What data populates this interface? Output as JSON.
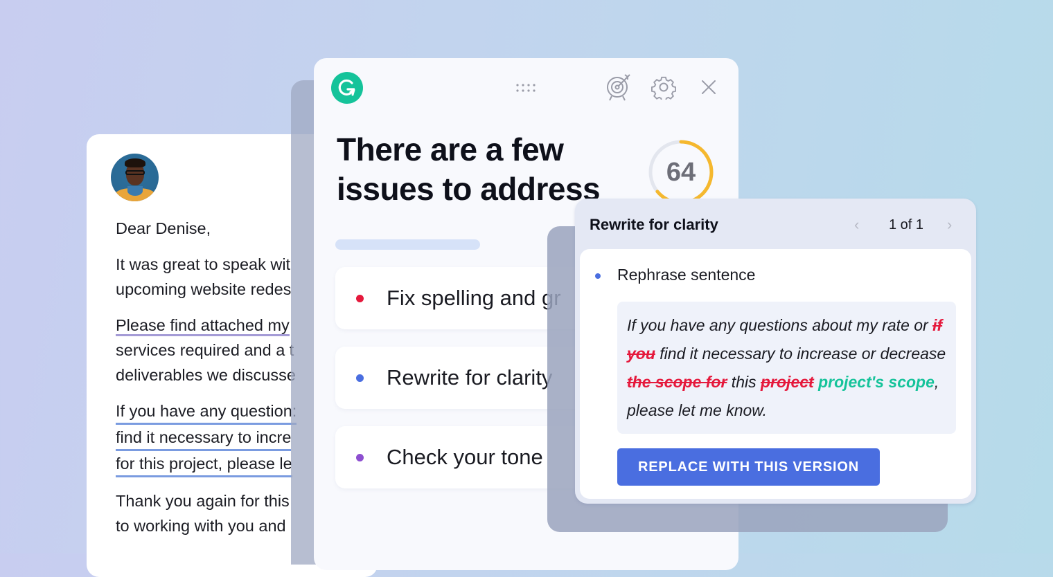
{
  "email": {
    "paragraphs": [
      {
        "lines": [
          "Dear Denise,"
        ]
      },
      {
        "lines": [
          "It was great to speak wit",
          "upcoming website redes"
        ]
      },
      {
        "lines": [
          "Please find attached my",
          "services required and a t",
          "deliverables we discusse"
        ]
      },
      {
        "lines": [
          "If you have any question:",
          "find it necessary to incre",
          "for this project, please le"
        ]
      },
      {
        "lines": [
          "Thank you again for this",
          "to working with you and"
        ]
      }
    ]
  },
  "panel": {
    "logo_icon": "grammarly-logo-icon",
    "drag_icon": "drag-handle-icon",
    "goals_icon": "target-icon",
    "settings_icon": "gear-icon",
    "close_icon": "close-icon",
    "headline_line1": "There are a few",
    "headline_line2": "issues to address",
    "score": {
      "value": "64",
      "fraction": 0.64
    },
    "progress_fraction": 0.2,
    "categories": [
      {
        "label": "Fix spelling and gr",
        "color": "#e5193c"
      },
      {
        "label": "Rewrite for clarity",
        "color": "#4a6ee0"
      },
      {
        "label": "Check your tone",
        "color": "#8d4fd0"
      }
    ]
  },
  "card": {
    "title": "Rewrite for clarity",
    "pager_prev": "‹",
    "pager_count": "1 of 1",
    "pager_next": "›",
    "suggestion_label": "Rephrase sentence",
    "diff": {
      "t1": "If you have any questions about my rate or ",
      "d1": "if you",
      "t2": " find it necessary to increase or decrease ",
      "d2": "the scope for",
      "t3": " this ",
      "d3": "project",
      "i1": "project's scope",
      "t4": ", please let me know."
    },
    "replace_button": "REPLACE WITH THIS VERSION"
  },
  "colors": {
    "brand_green": "#15c39a",
    "accent_blue": "#4a6ee0",
    "error_red": "#e5193c",
    "tone_purple": "#8d4fd0",
    "score_yellow": "#f5b82e"
  }
}
